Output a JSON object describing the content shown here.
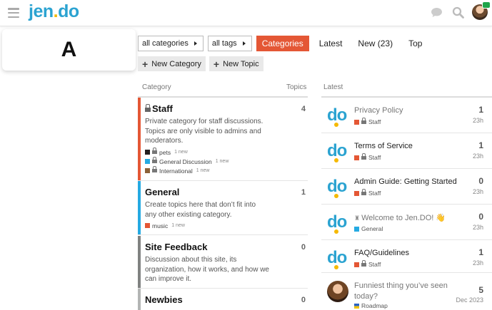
{
  "header": {
    "logo": {
      "j": "jen",
      "dot": ".",
      "do": "do"
    },
    "icons": [
      "hamburger-icon",
      "chat-icon",
      "search-icon",
      "avatar"
    ]
  },
  "sidebar_card": {
    "letter": "A"
  },
  "nav": {
    "category_filter": "all categories",
    "tag_filter": "all tags",
    "tabs": [
      {
        "label": "Categories",
        "active": true
      },
      {
        "label": "Latest",
        "active": false
      },
      {
        "label": "New (23)",
        "active": false
      },
      {
        "label": "Top",
        "active": false
      }
    ]
  },
  "actions": {
    "new_category": "New Category",
    "new_topic": "New Topic"
  },
  "columns": {
    "category": "Category",
    "topics": "Topics",
    "latest": "Latest"
  },
  "categories": [
    {
      "name": "Staff",
      "locked": true,
      "count": "4",
      "color": "#e45735",
      "desc": "Private category for staff discussions. Topics are only visible to admins and moderators.",
      "subs": [
        {
          "name": "pets",
          "new": "1 new",
          "color": "#231f20"
        },
        {
          "name": "General Discussion",
          "new": "1 new",
          "color": "#25aae2"
        },
        {
          "name": "International",
          "new": "1 new",
          "color": "#8c6238"
        }
      ]
    },
    {
      "name": "General",
      "locked": false,
      "count": "1",
      "color": "#25aae2",
      "desc": "Create topics here that don’t fit into any other existing category.",
      "subs": [
        {
          "name": "music",
          "new": "1 new",
          "color": "#e45735"
        }
      ]
    },
    {
      "name": "Site Feedback",
      "locked": false,
      "count": "0",
      "color": "#808281",
      "desc": "Discussion about this site, its organization, how it works, and how we can improve it.",
      "subs": []
    },
    {
      "name": "Newbies",
      "locked": false,
      "count": "0",
      "color": "#b3b5b4",
      "desc": "",
      "subs": []
    }
  ],
  "latest": [
    {
      "title": "Privacy Policy",
      "read": true,
      "category": "Staff",
      "cat_color": "#e45735",
      "locked": true,
      "count": "1",
      "age": "23h"
    },
    {
      "title": "Terms of Service",
      "read": false,
      "category": "Staff",
      "cat_color": "#e45735",
      "locked": true,
      "count": "1",
      "age": "23h"
    },
    {
      "title": "Admin Guide: Getting Started",
      "read": false,
      "category": "Staff",
      "cat_color": "#e45735",
      "locked": true,
      "count": "0",
      "age": "23h"
    },
    {
      "title": "Welcome to Jen.DO! 👋",
      "read": true,
      "category": "General",
      "cat_color": "#25aae2",
      "locked": false,
      "count": "0",
      "age": "23h"
    },
    {
      "title": "FAQ/Guidelines",
      "read": false,
      "category": "Staff",
      "cat_color": "#e45735",
      "locked": true,
      "count": "1",
      "age": "23h"
    },
    {
      "title": "Funniest thing you’ve seen today?",
      "read": true,
      "category": "Roadmap",
      "cat_color": "#f1c40f",
      "locked": false,
      "count": "5",
      "age": "Dec 2023"
    }
  ]
}
